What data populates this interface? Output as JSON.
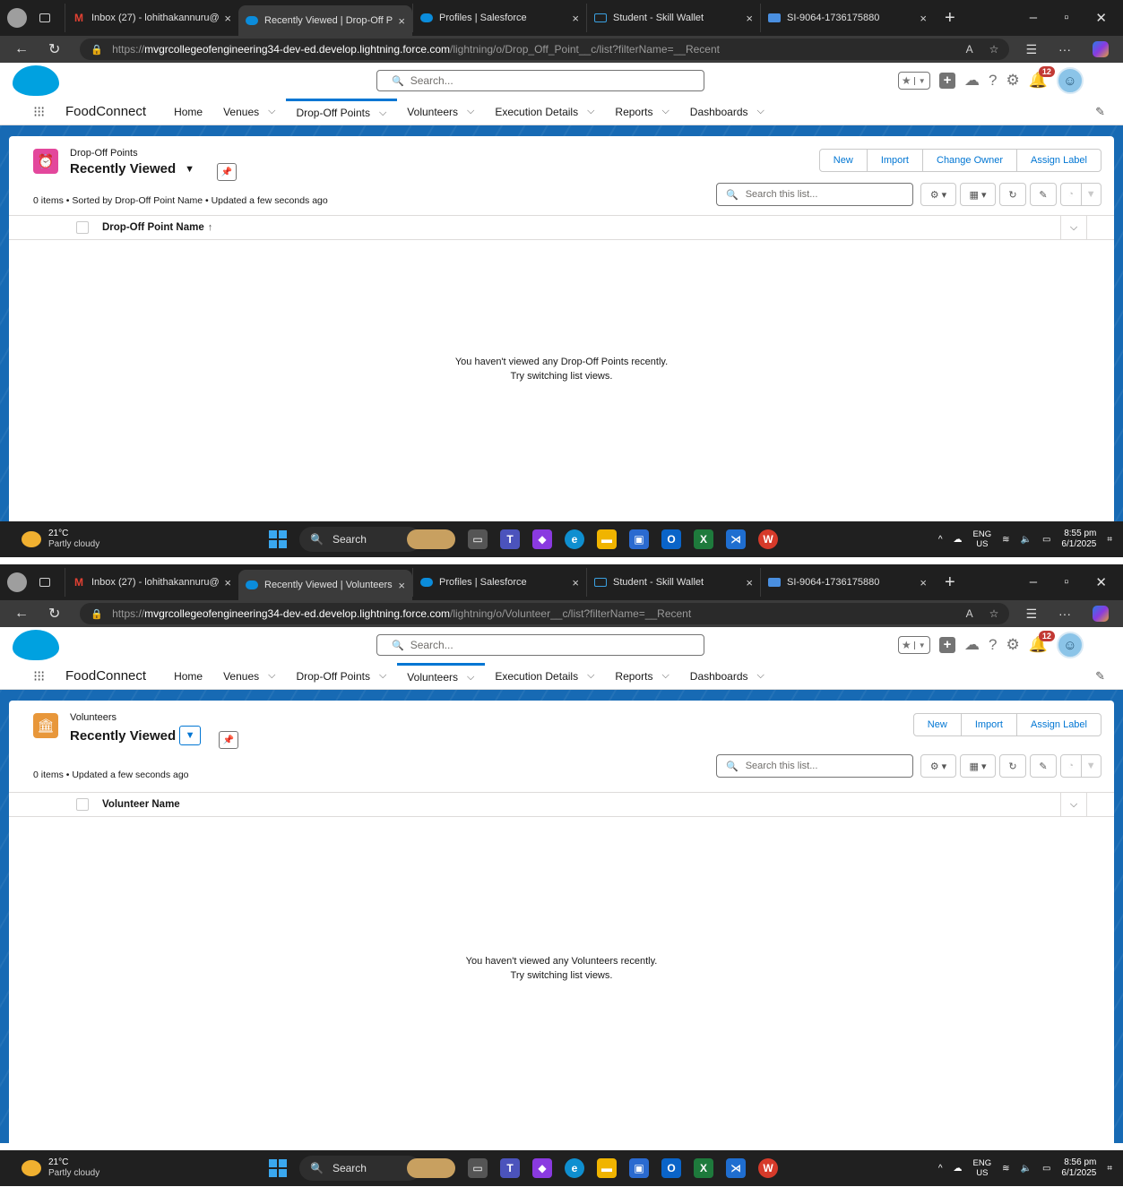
{
  "shots": [
    {
      "browser": {
        "tabs": [
          {
            "label": "Inbox (27) - lohithakannuru@",
            "favicon": "gmail-icon",
            "active": false
          },
          {
            "label": "Recently Viewed | Drop-Off P",
            "favicon": "salesforce-icon",
            "active": true
          },
          {
            "label": "Profiles | Salesforce",
            "favicon": "salesforce-icon",
            "active": false
          },
          {
            "label": "Student - Skill Wallet",
            "favicon": "skillwallet-icon",
            "active": false
          },
          {
            "label": "SI-9064-1736175880",
            "favicon": "doc-icon",
            "active": false
          }
        ],
        "url_scheme": "https://",
        "url_host": "mvgrcollegeofengineering34-dev-ed.develop.lightning.force.com",
        "url_path": "/lightning/o/Drop_Off_Point__c/list?filterName=__Recent"
      },
      "sf": {
        "search_placeholder": "Search...",
        "notification_count": "12",
        "app_name": "FoodConnect",
        "nav": [
          {
            "label": "Home",
            "chevron": false,
            "active": false
          },
          {
            "label": "Venues",
            "chevron": true,
            "active": false
          },
          {
            "label": "Drop-Off Points",
            "chevron": true,
            "active": true
          },
          {
            "label": "Volunteers",
            "chevron": true,
            "active": false
          },
          {
            "label": "Execution Details",
            "chevron": true,
            "active": false
          },
          {
            "label": "Reports",
            "chevron": true,
            "active": false
          },
          {
            "label": "Dashboards",
            "chevron": true,
            "active": false
          }
        ]
      },
      "listview": {
        "object_label": "Drop-Off Points",
        "icon_color": "#e3479c",
        "title": "Recently Viewed",
        "buttons": [
          "New",
          "Import",
          "Change Owner",
          "Assign Label"
        ],
        "status": "0 items • Sorted by Drop-Off Point Name • Updated a few seconds ago",
        "search_placeholder": "Search this list...",
        "column": "Drop-Off Point Name",
        "sorted": true,
        "empty_line1": "You haven't viewed any Drop-Off Points recently.",
        "empty_line2": "Try switching list views."
      },
      "taskbar": {
        "temp": "21°C",
        "condition": "Partly cloudy",
        "search_label": "Search",
        "lang1": "ENG",
        "lang2": "US",
        "time": "8:55 pm",
        "date": "6/1/2025"
      }
    },
    {
      "browser": {
        "tabs": [
          {
            "label": "Inbox (27) - lohithakannuru@",
            "favicon": "gmail-icon",
            "active": false
          },
          {
            "label": "Recently Viewed | Volunteers",
            "favicon": "salesforce-icon",
            "active": true
          },
          {
            "label": "Profiles | Salesforce",
            "favicon": "salesforce-icon",
            "active": false
          },
          {
            "label": "Student - Skill Wallet",
            "favicon": "skillwallet-icon",
            "active": false
          },
          {
            "label": "SI-9064-1736175880",
            "favicon": "doc-icon",
            "active": false
          }
        ],
        "url_scheme": "https://",
        "url_host": "mvgrcollegeofengineering34-dev-ed.develop.lightning.force.com",
        "url_path": "/lightning/o/Volunteer__c/list?filterName=__Recent"
      },
      "sf": {
        "search_placeholder": "Search...",
        "notification_count": "12",
        "app_name": "FoodConnect",
        "nav": [
          {
            "label": "Home",
            "chevron": false,
            "active": false
          },
          {
            "label": "Venues",
            "chevron": true,
            "active": false
          },
          {
            "label": "Drop-Off Points",
            "chevron": true,
            "active": false
          },
          {
            "label": "Volunteers",
            "chevron": true,
            "active": true
          },
          {
            "label": "Execution Details",
            "chevron": true,
            "active": false
          },
          {
            "label": "Reports",
            "chevron": true,
            "active": false
          },
          {
            "label": "Dashboards",
            "chevron": true,
            "active": false
          }
        ]
      },
      "listview": {
        "object_label": "Volunteers",
        "icon_color": "#e8973a",
        "title": "Recently Viewed",
        "buttons": [
          "New",
          "Import",
          "Assign Label"
        ],
        "status": "0 items • Updated a few seconds ago",
        "search_placeholder": "Search this list...",
        "column": "Volunteer Name",
        "sorted": false,
        "empty_line1": "You haven't viewed any Volunteers recently.",
        "empty_line2": "Try switching list views."
      },
      "taskbar": {
        "temp": "21°C",
        "condition": "Partly cloudy",
        "search_label": "Search",
        "lang1": "ENG",
        "lang2": "US",
        "time": "8:56 pm",
        "date": "6/1/2025"
      }
    }
  ]
}
